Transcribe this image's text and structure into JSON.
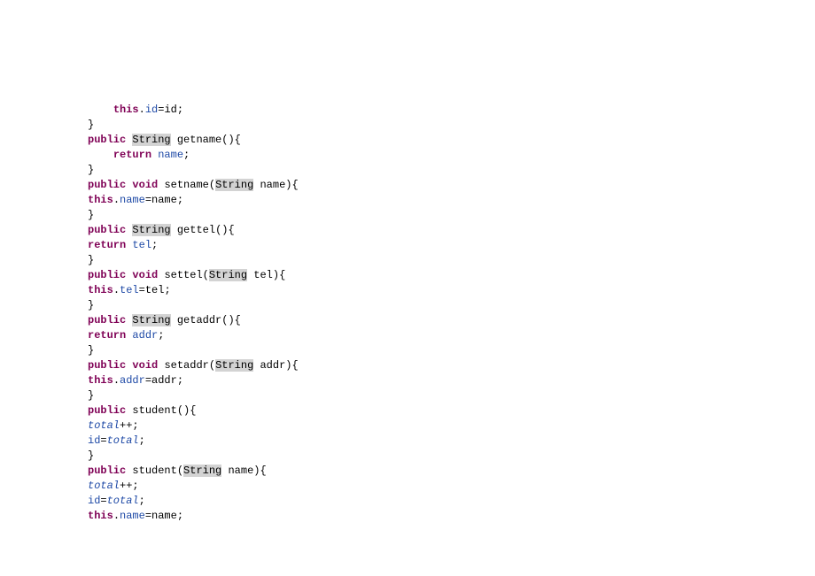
{
  "code": {
    "indent4": "    ",
    "this": "this",
    "public": "public",
    "void": "void",
    "return": "return",
    "String": "String",
    "lbrace": "{",
    "rbrace": "}",
    "dot": ".",
    "eq": "=",
    "semi": ";",
    "lparen": "(",
    "rparen": ")",
    "space": " ",
    "plusplus": "++",
    "id_m": "id",
    "id_p": "id",
    "name_m": "name",
    "name_p": "name",
    "tel_m": "tel",
    "tel_p": "tel",
    "addr_m": "addr",
    "addr_p": "addr",
    "total": "total",
    "getname": "getname",
    "setname": "setname",
    "gettel": "gettel",
    "settel": "settel",
    "getaddr": "getaddr",
    "setaddr": "setaddr",
    "student": "student"
  }
}
